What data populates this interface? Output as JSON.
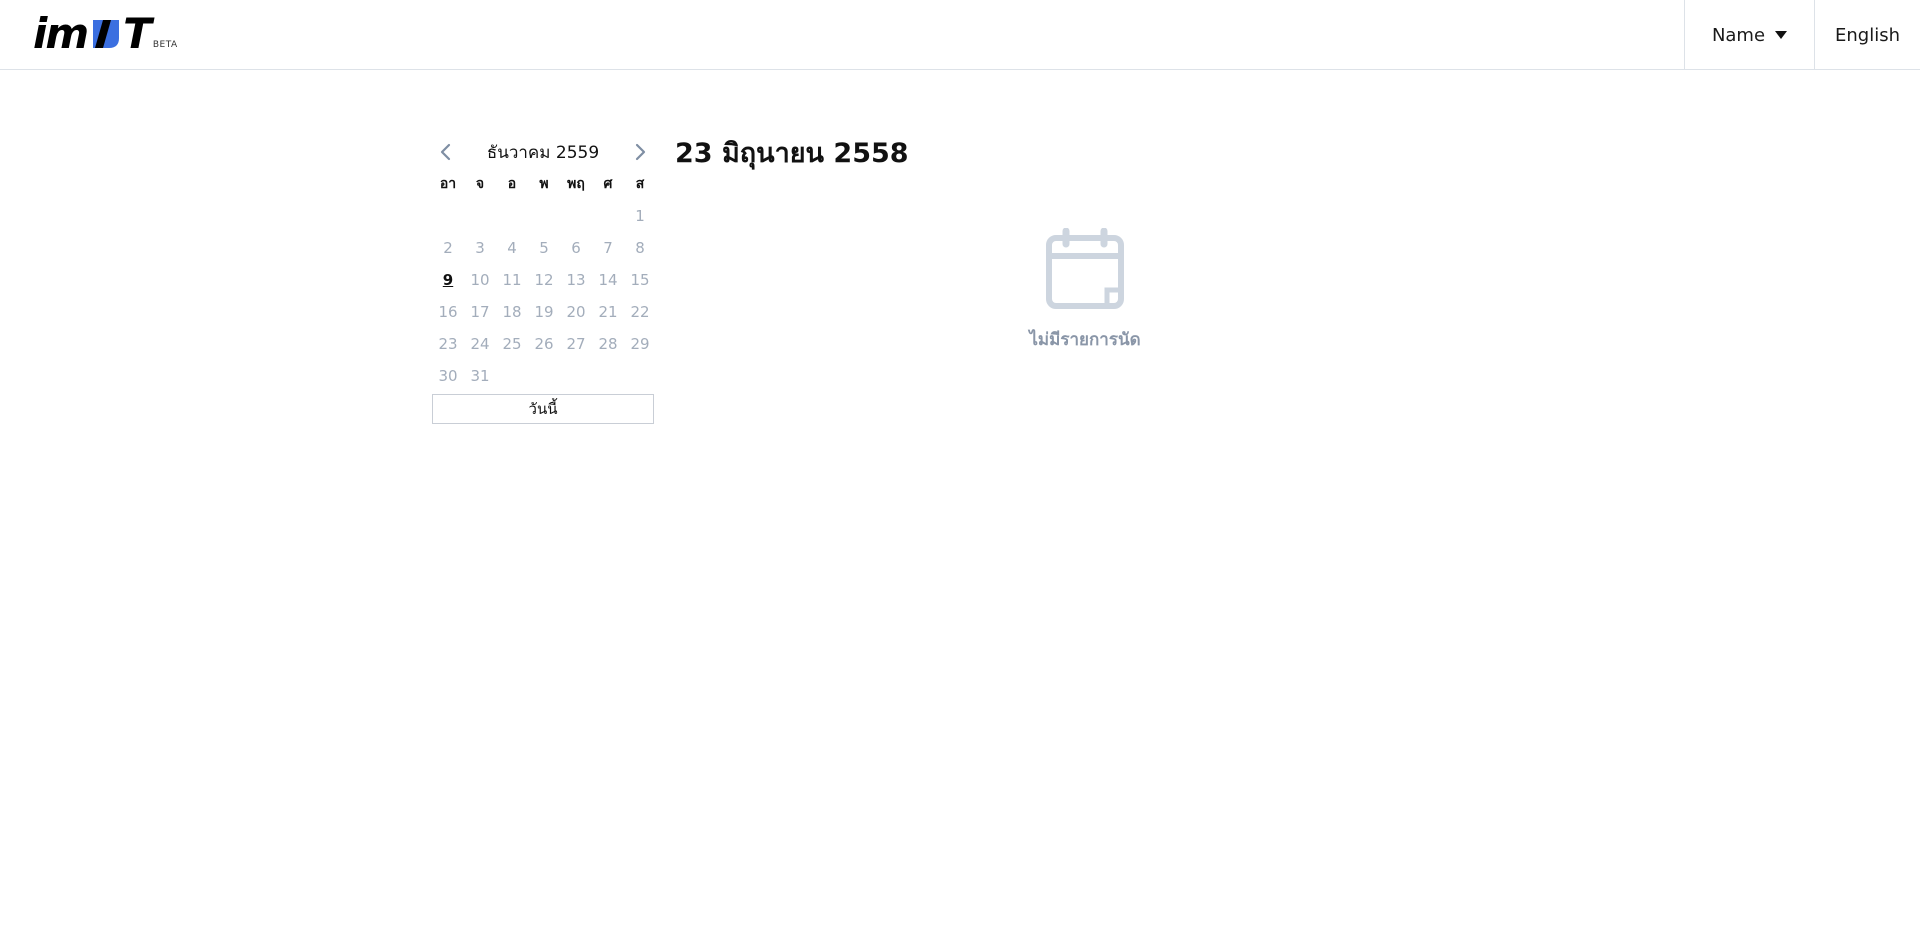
{
  "header": {
    "logo_text": "imPT",
    "logo_sub": "BETA",
    "user_menu_label": "Name",
    "language_label": "English"
  },
  "calendar": {
    "month_title": "ธันวาคม 2559",
    "weekdays": [
      "อา",
      "จ",
      "อ",
      "พ",
      "พฤ",
      "ศ",
      "ส"
    ],
    "leading_blanks": 6,
    "days": [
      "1",
      "2",
      "3",
      "4",
      "5",
      "6",
      "7",
      "8",
      "9",
      "10",
      "11",
      "12",
      "13",
      "14",
      "15",
      "16",
      "17",
      "18",
      "19",
      "20",
      "21",
      "22",
      "23",
      "24",
      "25",
      "26",
      "27",
      "28",
      "29",
      "30",
      "31"
    ],
    "today_day": "9",
    "today_button_label": "วันนี้"
  },
  "main": {
    "selected_date": "23 มิถุนายน 2558",
    "empty_message": "ไม่มีรายการนัด",
    "empty_icon": "calendar-icon"
  },
  "colors": {
    "accent_blue": "#3b6fe0",
    "muted_day": "#a3adbb",
    "empty_icon": "#cdd5df",
    "empty_text": "#8a96a8"
  }
}
